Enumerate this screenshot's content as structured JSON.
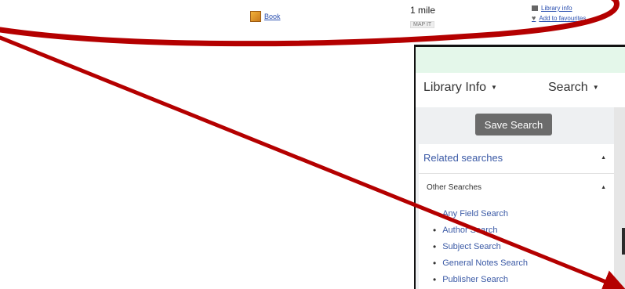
{
  "result_row": {
    "format_icon": "book-icon",
    "format_label": "Book",
    "distance": "1 mile",
    "map_it": "MAP IT",
    "library_info_link": "Library info",
    "add_to_favourites": "Add to favourites"
  },
  "panel": {
    "nav": [
      {
        "label": "Library Info"
      },
      {
        "label": "Search"
      }
    ],
    "save_search": "Save Search",
    "related_searches": "Related searches",
    "other_searches": "Other Searches",
    "search_links": [
      "Any Field Search",
      "Author Search",
      "Subject Search",
      "General Notes Search",
      "Publisher Search"
    ]
  },
  "colors": {
    "annotation": "#b40000",
    "panel_top": "#e4f7ea",
    "link": "#3b5aa6"
  }
}
